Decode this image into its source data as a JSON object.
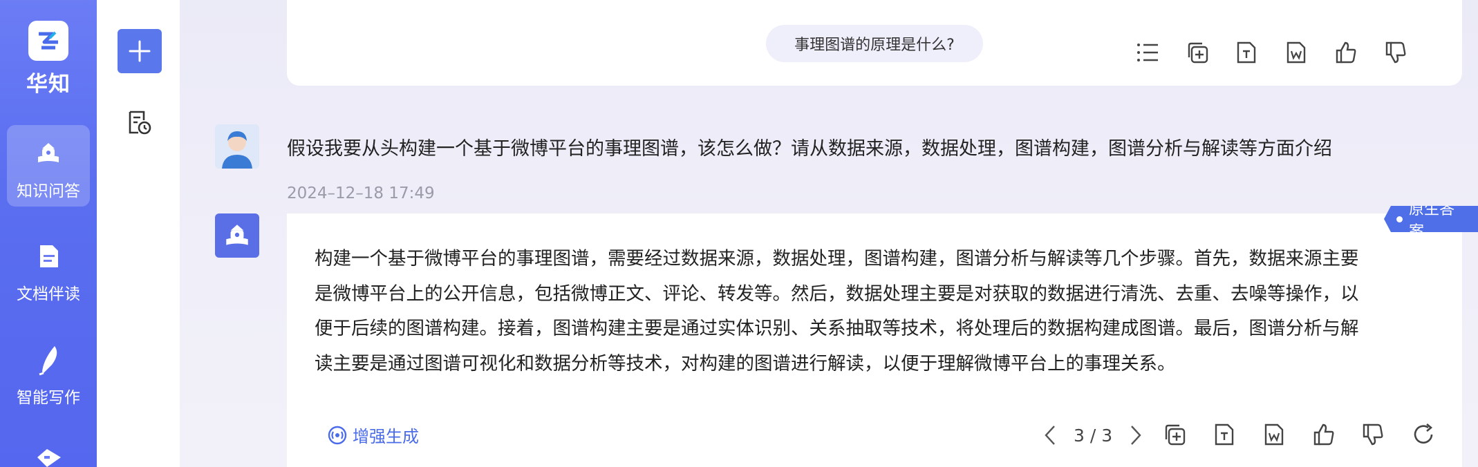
{
  "app": {
    "brand": "华知"
  },
  "nav": {
    "items": [
      {
        "label": "知识问答",
        "icon": "qa-book-icon",
        "active": true
      },
      {
        "label": "文档伴读",
        "icon": "document-icon",
        "active": false
      },
      {
        "label": "智能写作",
        "icon": "feather-pen-icon",
        "active": false
      }
    ]
  },
  "toolbar": {
    "new_icon": "plus-icon",
    "history_icon": "history-icon"
  },
  "top_card": {
    "question": "事理图谱的原理是什么?"
  },
  "conversation": {
    "user_question": "假设我要从头构建一个基于微博平台的事理图谱，该怎么做？请从数据来源，数据处理，图谱构建，图谱分析与解读等方面介绍",
    "timestamp": "2024–12–18 17:49",
    "answer_tag": "原生答案",
    "answer_lines": [
      "构建一个基于微博平台的事理图谱，需要经过数据来源，数据处理，图谱构建，图谱分析与解读等几个步骤。首先，数据来源主要",
      "是微博平台上的公开信息，包括微博正文、评论、转发等。然后，数据处理主要是对获取的数据进行清洗、去重、去噪等操作，以",
      "便于后续的图谱构建。接着，图谱构建主要是通过实体识别、关系抽取等技术，将处理后的数据构建成图谱。最后，图谱分析与解",
      "读主要是通过图谱可视化和数据分析等技术，对构建的图谱进行解读，以便于理解微博平台上的事理关系。"
    ],
    "enhance_label": "增强生成",
    "pager": "3 / 3"
  },
  "colors": {
    "rail": "#5b6ef0",
    "accent": "#4e6fe8",
    "pill_bg": "#efeefb"
  }
}
